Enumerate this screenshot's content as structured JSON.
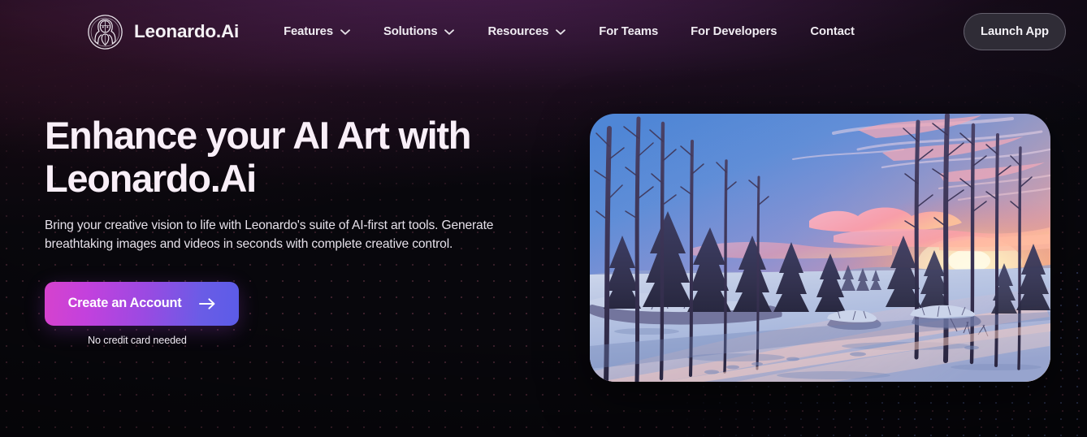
{
  "brand": {
    "name": "Leonardo.Ai",
    "logo_icon": "leonardo-face-logo-icon"
  },
  "nav": {
    "items": [
      {
        "label": "Features",
        "has_dropdown": true,
        "icon": "chevron-down-icon"
      },
      {
        "label": "Solutions",
        "has_dropdown": true,
        "icon": "chevron-down-icon"
      },
      {
        "label": "Resources",
        "has_dropdown": true,
        "icon": "chevron-down-icon"
      },
      {
        "label": "For Teams",
        "has_dropdown": false,
        "icon": ""
      },
      {
        "label": "For Developers",
        "has_dropdown": false,
        "icon": ""
      },
      {
        "label": "Contact",
        "has_dropdown": false,
        "icon": ""
      }
    ],
    "launch_label": "Launch App"
  },
  "hero": {
    "headline_line1": "Enhance your AI Art with",
    "headline_line2": "Leonardo.Ai",
    "subhead": "Bring your creative vision to life with Leonardo's suite of AI-first art tools. Generate breathtaking images and videos in seconds with complete creative control.",
    "cta_label": "Create an Account",
    "cta_arrow_icon": "arrow-right-icon",
    "cta_note": "No credit card needed",
    "image_alt": "Winter sunset landscape with snow field, bare trees and pine forest"
  },
  "colors": {
    "page_background": "#0a0710",
    "header_glow": "#763076",
    "headline_text": "#f9eff8",
    "body_text": "#e6e1ea",
    "cta_gradient_start": "#d642cd",
    "cta_gradient_end": "#5b5ce8",
    "launch_button_bg": "#2f2c36",
    "launch_button_border": "#bab6c8",
    "dot_grid_pink": "#ec7896",
    "dot_grid_blue": "#7896eb"
  }
}
